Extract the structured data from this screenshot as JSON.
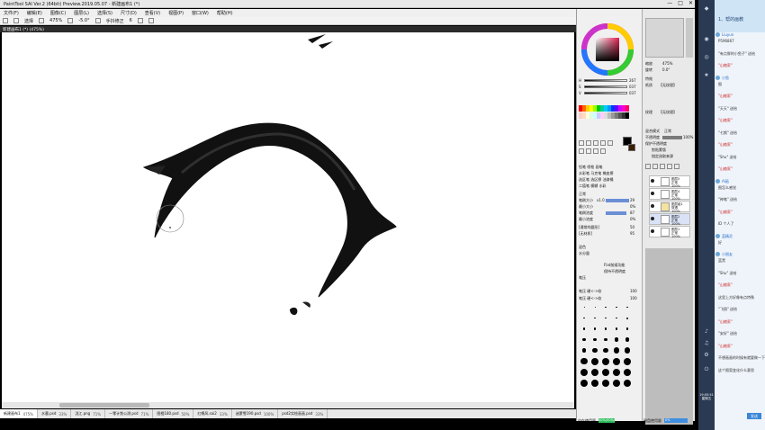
{
  "app": {
    "title": "PaintTool SAI Ver.2 (64bit) Preview.2019.05.07 - 新建画布1 (*)",
    "window_controls": [
      "—",
      "□",
      "✕"
    ]
  },
  "menu": [
    "文件(F)",
    "编辑(E)",
    "图像(C)",
    "图层(L)",
    "选择(S)",
    "尺寸(D)",
    "查看(V)",
    "视图(P)",
    "窗口(W)",
    "帮助(H)"
  ],
  "toolbar": {
    "select_label": "选择",
    "zoom": "475%",
    "angle": "-5.0°",
    "stabilizer_label": "手抖修正",
    "stabilizer_value": "6"
  },
  "document_tab": "新建画布1 (*) (475%)",
  "open_files": [
    {
      "name": "新建画布1",
      "zoom": "475%",
      "active": true
    },
    {
      "name": "水墨.psd",
      "zoom": "33%",
      "active": false
    },
    {
      "name": "泷江.png",
      "zoom": "71%",
      "active": false
    },
    {
      "name": "一零计划公测.psd",
      "zoom": "71%",
      "active": false
    },
    {
      "name": "图橙180.psd",
      "zoom": "50%",
      "active": false
    },
    {
      "name": "红棉风.sai2",
      "zoom": "33%",
      "active": false
    },
    {
      "name": "迷蒙雪190.psd",
      "zoom": "100%",
      "active": false
    },
    {
      "name": "psd2实绘画画.psd",
      "zoom": "33%",
      "active": false
    }
  ],
  "color_panel": {
    "h_label": "H",
    "h_value": "267",
    "s_label": "S",
    "s_value": "037",
    "v_label": "V",
    "v_value": "037"
  },
  "tool_panel": {
    "tool_rows": [
      [
        "铅笔",
        "喷枪",
        "画笔"
      ],
      [
        "水彩笔",
        "马克笔",
        "橡皮擦"
      ],
      [
        "选区笔",
        "选区擦",
        "油漆桶"
      ],
      [
        "二值笔",
        "模糊",
        "水彩"
      ]
    ],
    "mode_label": "正常",
    "size_label": "笔刷大小",
    "size_multiplier": "x1.0",
    "size_value": "29",
    "min_size_label": "最小大小",
    "min_size_value": "0%",
    "density_label": "笔刷浓度",
    "density_value": "87",
    "min_density_label": "最小浓度",
    "min_density_value": "0%",
    "shape_label": "[通常的圆形]",
    "shape_value": "50",
    "texture_label": "[无材质]",
    "texture_value": "95",
    "blend_label": "混色",
    "water_label": "水分量",
    "dilute_label": "Flat前缀功能",
    "keep_opacity_label": "保持不透明度",
    "press_label": "笔压",
    "press_min": "笔压 硬<->软",
    "press_min_value": "100",
    "press_max": "笔压 硬<->软",
    "press_max_value": "100"
  },
  "brush_size_grid": [
    [
      "0.8",
      "1",
      "1.5",
      "2",
      "2.3"
    ],
    [
      "2.6",
      "3",
      "3.5",
      "4",
      "5"
    ],
    [
      "6",
      "7",
      "8",
      "9",
      "10"
    ],
    [
      "12",
      "14",
      "16",
      "20",
      "25"
    ],
    [
      "30",
      "35",
      "40",
      "50",
      "60"
    ],
    [
      "70",
      "80",
      "100",
      "120",
      "150"
    ],
    [
      "170",
      "200",
      "250",
      "300",
      "350"
    ],
    [
      "400",
      "450",
      "500",
      "600",
      "700"
    ]
  ],
  "navigator": {
    "zoom_label": "缩放",
    "zoom_value": "475%",
    "angle_label": "旋转",
    "angle_value": "0.0°"
  },
  "layer_props": {
    "effect_label": "特效",
    "paper_label": "纸质",
    "paper_value": "【无纹理】",
    "pattern_label": "纹理",
    "pattern_value": "【无纹理】",
    "blend_mode_label": "混合模式",
    "blend_mode_value": "正常",
    "opacity_label": "不透明度",
    "opacity_value": "100%",
    "preserve_label": "保护不透明度",
    "clip_label": "剪贴蒙版",
    "selection_source_label": "指定选取来源"
  },
  "layers": [
    {
      "name": "图层5",
      "mode": "正常",
      "opacity": "100%",
      "selected": false
    },
    {
      "name": "图层4",
      "mode": "正常",
      "opacity": "100%",
      "selected": false
    },
    {
      "name": "图层组1",
      "mode": "穿透",
      "opacity": "100%",
      "selected": false
    },
    {
      "name": "图层2",
      "mode": "正常",
      "opacity": "100%",
      "selected": true
    },
    {
      "name": "图层1",
      "mode": "正常",
      "opacity": "100%",
      "selected": false
    }
  ],
  "status": {
    "memory_label": "内存使用量",
    "memory_value": "50%(50%)",
    "disk_label": "磁盘使用量",
    "disk_value": "0%"
  },
  "chat": {
    "panel_title": "1、帮的画教",
    "messages": [
      {
        "user": "Liuyun",
        "text": ""
      },
      {
        "user": "",
        "text": "P596867"
      },
      {
        "user": "",
        "text": "\"有点胖的小鱼子\" 送给"
      },
      {
        "user": "",
        "text": "\"山楂家\""
      },
      {
        "user": "小鱼",
        "text": "图"
      },
      {
        "user": "",
        "text": "\"山楂家\""
      },
      {
        "user": "",
        "text": "\"天天\" 送给"
      },
      {
        "user": "",
        "text": "\"山楂家\""
      },
      {
        "user": "",
        "text": "\"七颜\" 送给"
      },
      {
        "user": "",
        "text": "\"山楂家\""
      },
      {
        "user": "",
        "text": "\"Shu\" 送给"
      },
      {
        "user": "",
        "text": "\"山楂家\""
      },
      {
        "user": "AI画",
        "text": "图怎么感觉"
      },
      {
        "user": "",
        "text": "\"神笔\" 送给"
      },
      {
        "user": "",
        "text": "\"山楂家\""
      },
      {
        "user": "",
        "text": "ID 个人了"
      },
      {
        "user": "蓝精灵",
        "text": "好"
      },
      {
        "user": "小朋友",
        "text": "蓝黑"
      },
      {
        "user": "",
        "text": "\"Shu\" 送给"
      },
      {
        "user": "",
        "text": "\"山楂家\""
      },
      {
        "user": "",
        "text": "这里上方好像有点特殊"
      },
      {
        "user": "",
        "text": "\"飞翔\" 送给"
      },
      {
        "user": "",
        "text": "\"山楂家\""
      },
      {
        "user": "",
        "text": "\"安好\" 送给"
      },
      {
        "user": "",
        "text": "\"山楂家\""
      },
      {
        "user": "",
        "text": "不想画画的时候有就要做一下"
      },
      {
        "user": "",
        "text": "这个图案变化什么意思"
      }
    ],
    "time": "19:05:51",
    "date": "星期五",
    "send_label": "发送"
  }
}
